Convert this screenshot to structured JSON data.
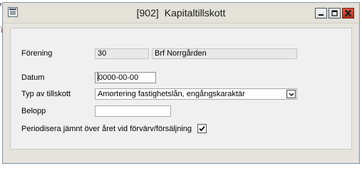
{
  "window": {
    "title_number": "[902]",
    "title_text": "Kapitaltillskott",
    "icons": {
      "system_menu": "form-icon",
      "minimize": "minimize-icon",
      "maximize": "maximize-icon",
      "close": "close-icon"
    },
    "colors": {
      "close_button": "#c8412a",
      "client_area": "#f0f0f0",
      "frame": "#e6e4dc"
    }
  },
  "form": {
    "forening": {
      "label": "Förening",
      "code": "30",
      "name": "Brf Norrgården"
    },
    "datum": {
      "label": "Datum",
      "value": "0000-00-00"
    },
    "typ": {
      "label": "Typ av tillskott",
      "value": "Amortering fastighetslån, engångskaraktär",
      "icon": "chevron-down-icon"
    },
    "belopp": {
      "label": "Belopp",
      "value": ""
    },
    "periodisera": {
      "label": "Periodisera jämnt över året vid förvärv/försäljning",
      "checked": true,
      "icon": "checkmark-icon"
    }
  }
}
